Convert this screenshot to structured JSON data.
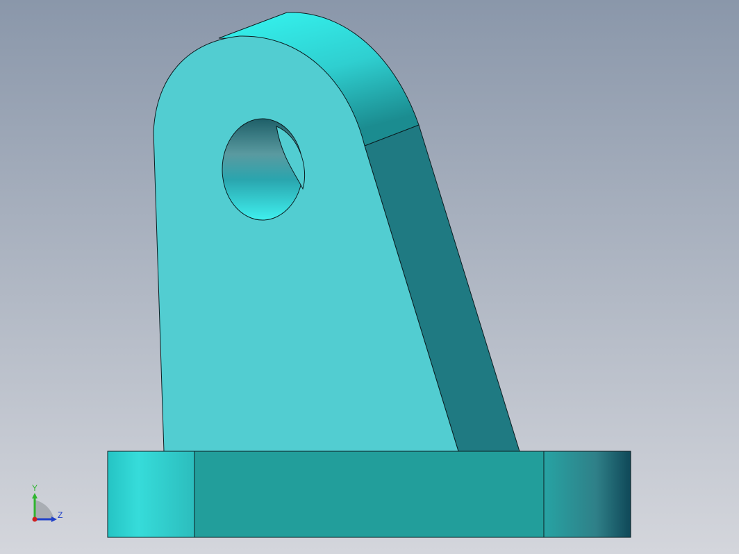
{
  "viewport": {
    "background_top": "#8a97aa",
    "background_bottom": "#d4d6dc"
  },
  "model": {
    "colors": {
      "face_light": "#52cdd1",
      "face_dark": "#1f7a82",
      "base_front": "#229e9b",
      "top_highlight": "#35f5f0",
      "edge": "#0b1e22"
    }
  },
  "triad": {
    "y_label": "Y",
    "z_label": "Z",
    "y_color": "#2fb52f",
    "z_color": "#2040c8",
    "x_color": "#d02020"
  }
}
